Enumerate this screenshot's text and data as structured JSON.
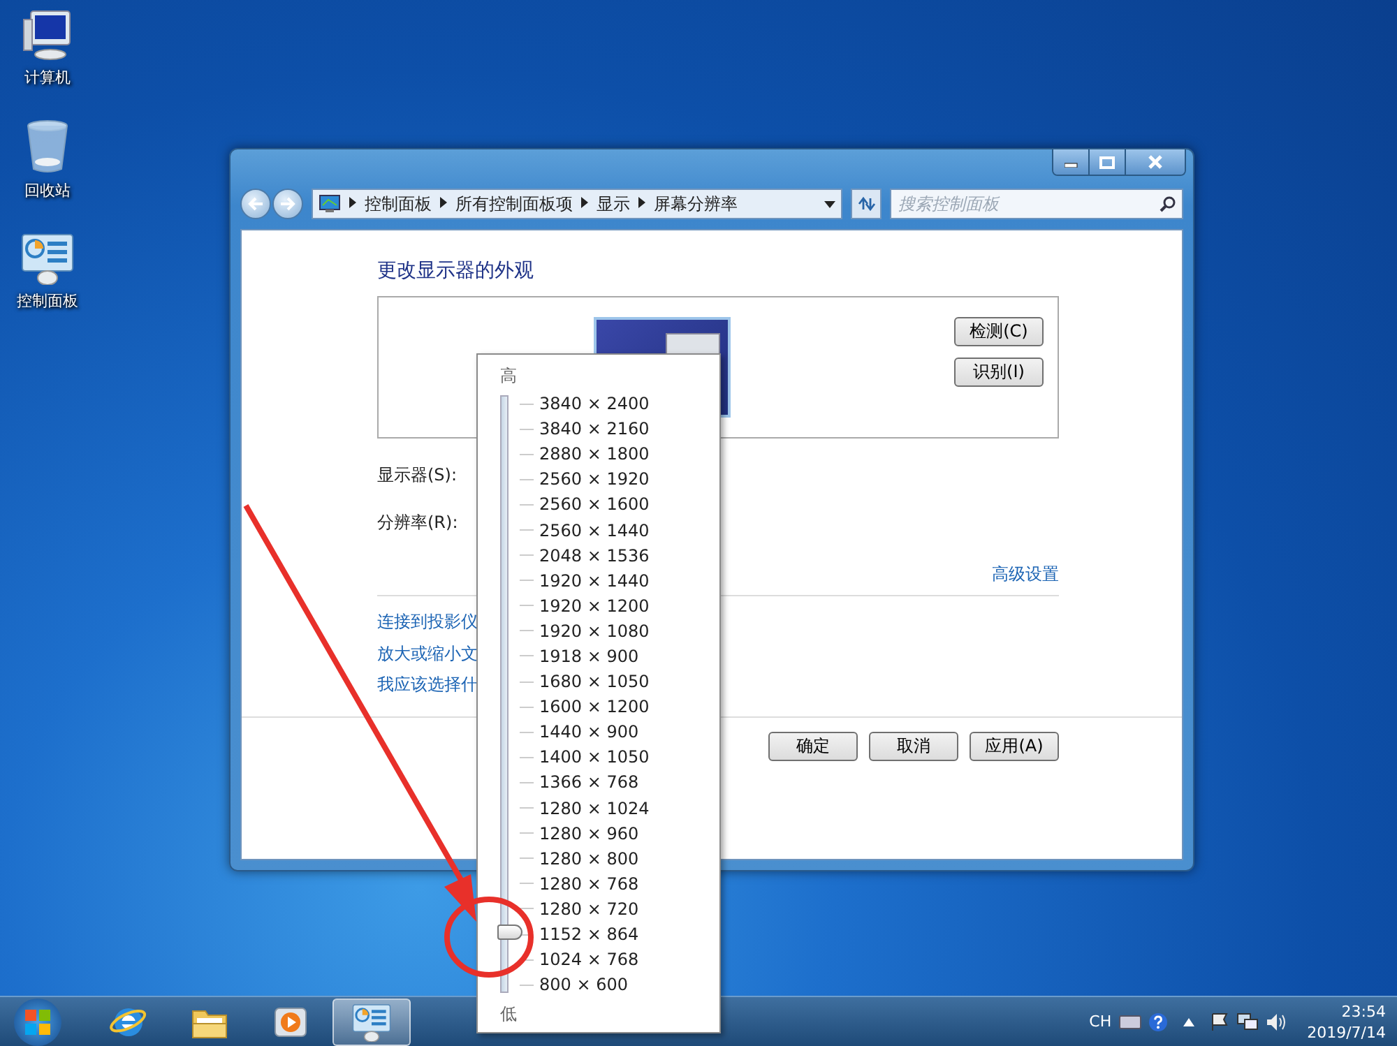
{
  "desktop_icons": [
    {
      "label": "计算机",
      "kind": "computer"
    },
    {
      "label": "回收站",
      "kind": "recycle"
    },
    {
      "label": "控制面板",
      "kind": "control"
    }
  ],
  "window": {
    "address": {
      "path": [
        "控制面板",
        "所有控制面板项",
        "显示",
        "屏幕分辨率"
      ]
    },
    "search": {
      "placeholder": "搜索控制面板"
    },
    "heading": "更改显示器的外观",
    "side_buttons": [
      "检测(C)",
      "识别(I)"
    ],
    "fields": [
      "显示器(S):",
      "分辨率(R):"
    ],
    "advanced_link": "高级设置",
    "links": [
      "连接到投影仪",
      "放大或缩小文",
      "我应该选择什"
    ],
    "buttons": [
      "确定",
      "取消",
      "应用(A)"
    ]
  },
  "resolution_dropdown": {
    "high_label": "高",
    "low_label": "低",
    "level": 0.0909,
    "options": [
      "3840 × 2400",
      "3840 × 2160",
      "2880 × 1800",
      "2560 × 1920",
      "2560 × 1600",
      "2560 × 1440",
      "2048 × 1536",
      "1920 × 1440",
      "1920 × 1200",
      "1920 × 1080",
      "1918 × 900",
      "1680 × 1050",
      "1600 × 1200",
      "1440 × 900",
      "1400 × 1050",
      "1366 × 768",
      "1280 × 1024",
      "1280 × 960",
      "1280 × 800",
      "1280 × 768",
      "1280 × 720",
      "1152 × 864",
      "1024 × 768",
      "800 × 600"
    ]
  },
  "taskbar": {
    "items": [
      {
        "kind": "browser",
        "selected": false
      },
      {
        "kind": "folder",
        "selected": false
      },
      {
        "kind": "media",
        "selected": false
      },
      {
        "kind": "control",
        "selected": true
      }
    ],
    "language": "CH",
    "time": "23:54",
    "date": "2019/7/14"
  }
}
